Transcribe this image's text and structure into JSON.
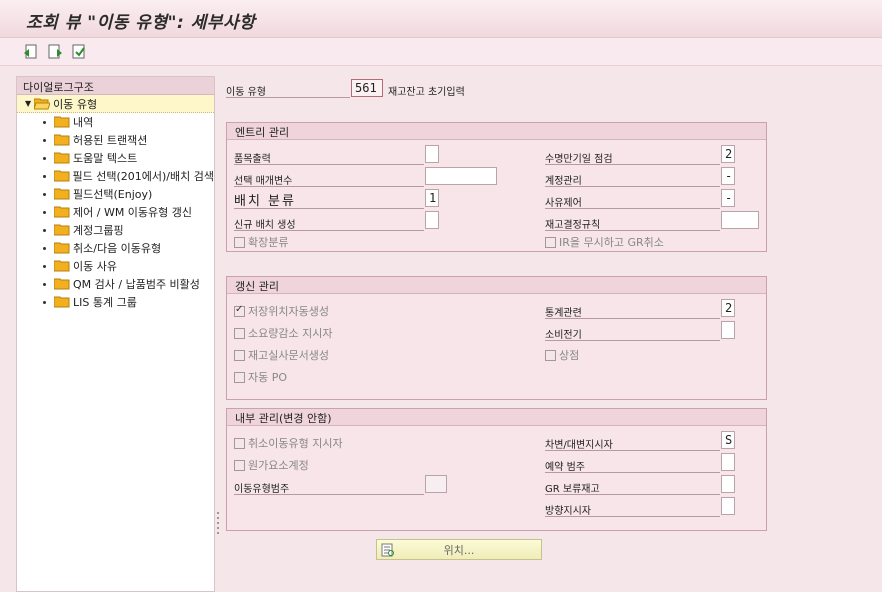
{
  "window": {
    "title": "조회 뷰 \"이동 유형\": 세부사항"
  },
  "toolbar": {
    "icons": [
      "prev-entry-icon",
      "next-entry-icon",
      "select-entry-icon"
    ]
  },
  "tree": {
    "header": "다이얼로그구조",
    "root": "이동 유형",
    "items": [
      "내역",
      "허용된 트랜잭션",
      "도움말 텍스트",
      "필드 선택(201에서)/배치 검색",
      "필드선택(Enjoy)",
      "제어 / WM 이동유형 갱신",
      "계정그룹핑",
      "취소/다음 이동유형",
      "이동 사유",
      "QM 검사 / 납품범주 비활성",
      "LIS 통계 그룹"
    ]
  },
  "header": {
    "label": "이동 유형",
    "value": "561",
    "description": "재고잔고 초기입력"
  },
  "entry": {
    "title": "엔트리 관리",
    "print_item": "품목출력",
    "select_print_param": "선택 매개변수",
    "batch_class": "배치 분류",
    "batch_class_value": "1",
    "new_batch": "신규 배치 생성",
    "ext_class": "확장분류",
    "shelf_life_check": "수명만기일 점검",
    "shelf_life_value": "2",
    "account_control": "계정관리",
    "account_value": "-",
    "reason_control": "사유제어",
    "reason_value": "-",
    "stock_rule": "재고결정규칙",
    "ignore_ir": "IR을 무시하고 GR취소"
  },
  "update": {
    "title": "갱신 관리",
    "auto_storage": "저장위치자동생성",
    "consumption_post": "소요량감소 지시자",
    "phys_inv": "재고실사문서생성",
    "auto_po": "자동 PO",
    "stat_rel": "통계관련",
    "stat_value": "2",
    "consumption": "소비전기",
    "goods": "상점"
  },
  "internal": {
    "title": "내부 관리(변경 안함)",
    "reversal": "취소이동유형 지시자",
    "cost_acc": "원가요소계정",
    "mvt_cat": "이동유형범주",
    "dc_ind": "차변/대변지시자",
    "dc_value": "S",
    "reservation": "예약 범주",
    "gr_blocked": "GR 보류재고",
    "direction": "방향지시자"
  },
  "position_button": "위치..."
}
